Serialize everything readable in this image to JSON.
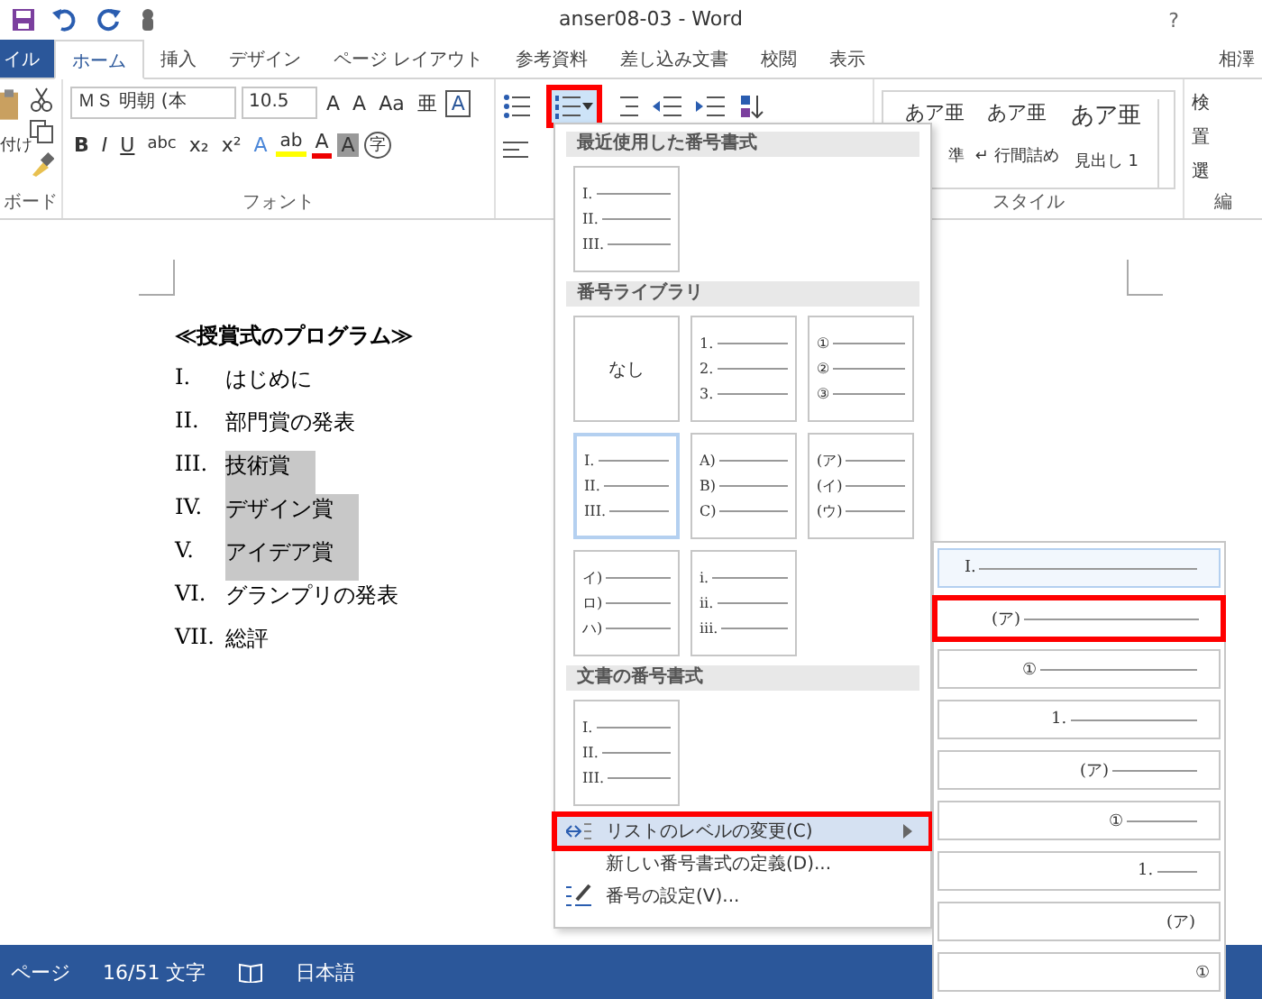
{
  "title_bar": {
    "title": "anser08-03 - Word",
    "help": "?"
  },
  "tabs": [
    {
      "label": "イル",
      "kind": "file",
      "selected": false
    },
    {
      "label": "ホーム",
      "kind": "tab",
      "selected": true
    },
    {
      "label": "挿入",
      "kind": "tab",
      "selected": false
    },
    {
      "label": "デザイン",
      "kind": "tab",
      "selected": false
    },
    {
      "label": "ページ レイアウト",
      "kind": "tab",
      "selected": false
    },
    {
      "label": "参考資料",
      "kind": "tab",
      "selected": false
    },
    {
      "label": "差し込み文書",
      "kind": "tab",
      "selected": false
    },
    {
      "label": "校閲",
      "kind": "tab",
      "selected": false
    },
    {
      "label": "表示",
      "kind": "tab",
      "selected": false
    },
    {
      "label": "相澤",
      "kind": "user",
      "selected": false
    }
  ],
  "ribbon": {
    "clipboard": {
      "paste_label": "付け",
      "group_label": "ボード"
    },
    "font": {
      "font_name": "ＭＳ 明朝 (本",
      "font_size": "10.5",
      "row1": [
        "A",
        "A",
        "Aa",
        "亜",
        "A"
      ],
      "row2": [
        "B",
        "I",
        "U",
        "abc",
        "x₂",
        "x²",
        "A",
        "ab",
        "A",
        "A",
        "字"
      ],
      "group_label": "フォント"
    },
    "paragraph": {
      "numbering_callout": true
    },
    "styles": {
      "items": [
        {
          "preview": "あア亜",
          "name": "準"
        },
        {
          "preview": "あア亜",
          "name": "↵ 行間詰め"
        },
        {
          "preview": "あア亜",
          "name": "見出し 1"
        }
      ],
      "group_label": "スタイル"
    },
    "editing": {
      "items": [
        "検",
        "置",
        "選"
      ],
      "group_label": "編"
    }
  },
  "document": {
    "heading": "≪授賞式のプログラム≫",
    "items": [
      {
        "number": "I.",
        "text": "はじめに",
        "selected": false
      },
      {
        "number": "II.",
        "text": "部門賞の発表",
        "selected": false
      },
      {
        "number": "III.",
        "text": "技術賞",
        "selected": true
      },
      {
        "number": "IV.",
        "text": "デザイン賞",
        "selected": true
      },
      {
        "number": "V.",
        "text": "アイデア賞",
        "selected": true
      },
      {
        "number": "VI.",
        "text": "グランプリの発表",
        "selected": false
      },
      {
        "number": "VII.",
        "text": "総評",
        "selected": false
      }
    ]
  },
  "numbering_menu": {
    "sections": [
      {
        "title": "最近使用した番号書式",
        "tiles": [
          {
            "kind": "list",
            "markers": [
              "I.",
              "II.",
              "III."
            ],
            "selected": false
          }
        ]
      },
      {
        "title": "番号ライブラリ",
        "tiles": [
          {
            "kind": "none",
            "label": "なし",
            "selected": false
          },
          {
            "kind": "list",
            "markers": [
              "1.",
              "2.",
              "3."
            ],
            "selected": false
          },
          {
            "kind": "list",
            "markers": [
              "①",
              "②",
              "③"
            ],
            "selected": false
          },
          {
            "kind": "list",
            "markers": [
              "I.",
              "II.",
              "III."
            ],
            "selected": true
          },
          {
            "kind": "list",
            "markers": [
              "A)",
              "B)",
              "C)"
            ],
            "selected": false
          },
          {
            "kind": "list",
            "markers": [
              "(ア)",
              "(イ)",
              "(ウ)"
            ],
            "selected": false
          },
          {
            "kind": "list",
            "markers": [
              "イ)",
              "ロ)",
              "ハ)"
            ],
            "selected": false
          },
          {
            "kind": "list",
            "markers": [
              "i.",
              "ii.",
              "iii."
            ],
            "selected": false
          }
        ]
      },
      {
        "title": "文書の番号書式",
        "tiles": [
          {
            "kind": "list",
            "markers": [
              "I.",
              "II.",
              "III."
            ],
            "selected": false
          }
        ]
      }
    ],
    "commands": [
      {
        "label": "リストのレベルの変更(C)",
        "highlighted": true,
        "submenu": true,
        "callout": true
      },
      {
        "label": "新しい番号書式の定義(D)...",
        "highlighted": false,
        "submenu": false,
        "callout": false
      },
      {
        "label": "番号の設定(V)...",
        "highlighted": false,
        "submenu": false,
        "callout": false
      }
    ]
  },
  "level_submenu": {
    "items": [
      {
        "marker": "I.",
        "selected": true,
        "callout": false
      },
      {
        "marker": "(ア)",
        "selected": false,
        "callout": true
      },
      {
        "marker": "①",
        "selected": false,
        "callout": false
      },
      {
        "marker": "1.",
        "selected": false,
        "callout": false
      },
      {
        "marker": "(ア)",
        "selected": false,
        "callout": false
      },
      {
        "marker": "①",
        "selected": false,
        "callout": false
      },
      {
        "marker": "1.",
        "selected": false,
        "callout": false
      },
      {
        "marker": "(ア)",
        "selected": false,
        "callout": false
      },
      {
        "marker": "①",
        "selected": false,
        "callout": false
      }
    ]
  },
  "status_bar": {
    "items": [
      "ページ",
      "16/51 文字",
      "日本語"
    ]
  }
}
